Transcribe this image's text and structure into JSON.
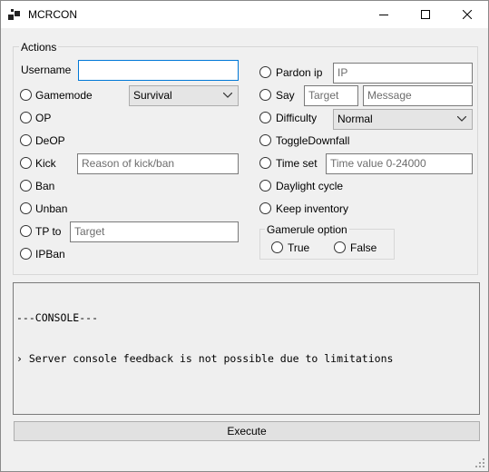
{
  "window": {
    "title": "MCRCON"
  },
  "actions": {
    "group_label": "Actions",
    "username_label": "Username",
    "username_value": "",
    "gamemode": {
      "label": "Gamemode",
      "selected": "Survival"
    },
    "op": "OP",
    "deop": "DeOP",
    "kick": {
      "label": "Kick",
      "placeholder": "Reason of kick/ban"
    },
    "ban": "Ban",
    "unban": "Unban",
    "tp": {
      "label": "TP to",
      "placeholder": "Target"
    },
    "ipban": "IPBan",
    "pardon": {
      "label": "Pardon ip",
      "placeholder": "IP"
    },
    "say": {
      "label": "Say",
      "target_placeholder": "Target",
      "message_placeholder": "Message"
    },
    "difficulty": {
      "label": "Difficulty",
      "selected": "Normal"
    },
    "toggle_downfall": "ToggleDownfall",
    "time_set": {
      "label": "Time set",
      "placeholder": "Time value 0-24000"
    },
    "daylight_cycle": "Daylight cycle",
    "keep_inventory": "Keep inventory",
    "gamerule": {
      "label": "Gamerule option",
      "true_label": "True",
      "false_label": "False"
    }
  },
  "console": {
    "lines": [
      "---CONSOLE---",
      "› Server console feedback is not possible due to limitations"
    ]
  },
  "execute_label": "Execute"
}
